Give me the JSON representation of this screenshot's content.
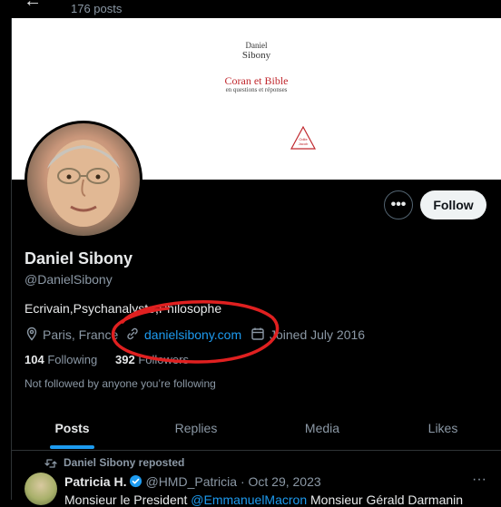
{
  "header": {
    "post_count": "176 posts"
  },
  "banner": {
    "author_first": "Daniel",
    "author_last": "Sibony",
    "book_title": "Coran et Bible",
    "book_subtitle": "en questions et réponses",
    "publisher": "Odile Jacob"
  },
  "profile": {
    "more_label": "•••",
    "follow_label": "Follow",
    "name": "Daniel Sibony",
    "handle": "@DanielSibony",
    "bio": "Ecrivain,Psychanalyste,Philosophe",
    "location": "Paris, France",
    "website": "danielsibony.com",
    "joined": "Joined July 2016",
    "following_count": "104",
    "following_label": "Following",
    "followers_count": "392",
    "followers_label": "Followers",
    "not_followed": "Not followed by anyone you’re following"
  },
  "tabs": [
    "Posts",
    "Replies",
    "Media",
    "Likes"
  ],
  "tweet": {
    "repost_text": "Daniel Sibony reposted",
    "author": "Patricia H.",
    "handle": "@HMD_Patricia",
    "date": "· Oct 29, 2023",
    "more": "···",
    "text_start": "Monsieur le President ",
    "mention": "@EmmanuelMacron",
    "text_end": " Monsieur Gérald Darmanin"
  },
  "colors": {
    "accent": "#1d9bf0",
    "annotation": "#e02020"
  },
  "icons": [
    "back-arrow-icon",
    "location-icon",
    "link-icon",
    "calendar-icon",
    "repost-icon",
    "verified-badge-icon",
    "more-icon"
  ]
}
